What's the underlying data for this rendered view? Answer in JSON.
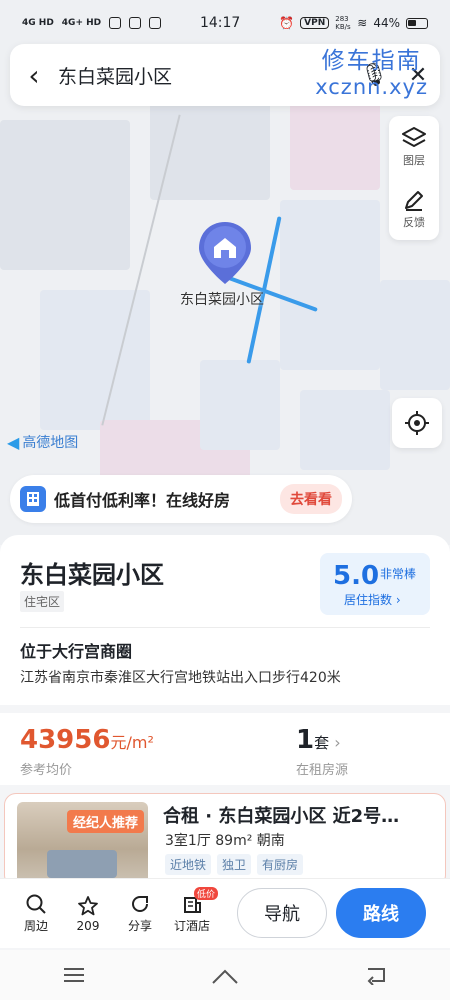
{
  "status_bar": {
    "sig1": "4G HD",
    "sig2": "4G+ HD",
    "time": "14:17",
    "vpn": "VPN",
    "speed": "283 KB/s",
    "battery": "44%"
  },
  "search": {
    "query": "东白菜园小区"
  },
  "watermark": {
    "line1": "修车指南",
    "line2": "xcznn.xyz"
  },
  "map_tools": {
    "layers": "图层",
    "feedback": "反馈"
  },
  "map": {
    "pin_label": "东白菜园小区",
    "logo": "高德地图"
  },
  "promo": {
    "text": "低首付低利率！在线好房",
    "button": "去看看"
  },
  "poi": {
    "name": "东白菜园小区",
    "type": "住宅区",
    "score": "5.0",
    "score_word": "非常棒",
    "score_label": "居住指数",
    "district": "位于大行宫商圈",
    "address": "江苏省南京市秦淮区大行宫地铁站出入口步行420米"
  },
  "stats": {
    "price": "43956",
    "price_unit": "元/m²",
    "price_label": "参考均价",
    "rent_count": "1",
    "rent_unit": "套",
    "rent_label": "在租房源"
  },
  "listing": {
    "badge": "经纪人推荐",
    "title": "合租 · 东白菜园小区 近2号…",
    "spec": "3室1厅 89m² 朝南",
    "tags": [
      "近地铁",
      "独卫",
      "有厨房"
    ]
  },
  "bottom_bar": {
    "nearby": "周边",
    "favorites_count": "209",
    "share": "分享",
    "hotel": "订酒店",
    "hotel_badge": "低价",
    "navigate": "导航",
    "route": "路线"
  }
}
